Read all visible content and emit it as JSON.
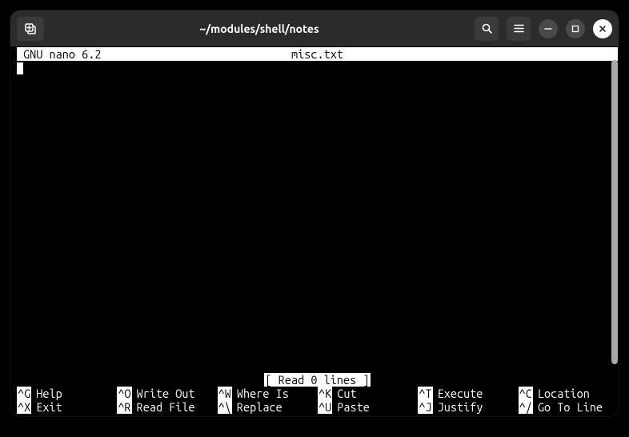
{
  "window": {
    "title": "~/modules/shell/notes"
  },
  "nano": {
    "app_name": "GNU nano 6.2",
    "filename": "misc.txt",
    "status": "[ Read 0 lines ]",
    "shortcuts": [
      {
        "key": "^G",
        "label": "Help"
      },
      {
        "key": "^X",
        "label": "Exit"
      },
      {
        "key": "^O",
        "label": "Write Out"
      },
      {
        "key": "^R",
        "label": "Read File"
      },
      {
        "key": "^W",
        "label": "Where Is"
      },
      {
        "key": "^\\",
        "label": "Replace"
      },
      {
        "key": "^K",
        "label": "Cut"
      },
      {
        "key": "^U",
        "label": "Paste"
      },
      {
        "key": "^T",
        "label": "Execute"
      },
      {
        "key": "^J",
        "label": "Justify"
      },
      {
        "key": "^C",
        "label": "Location"
      },
      {
        "key": "^/",
        "label": "Go To Line"
      }
    ]
  }
}
